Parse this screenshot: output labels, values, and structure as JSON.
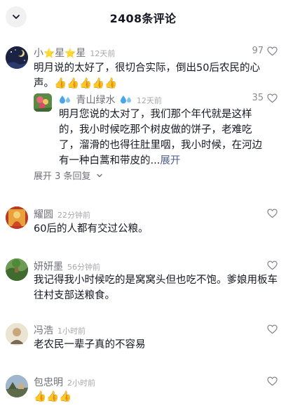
{
  "header": {
    "title": "2408条评论"
  },
  "comments": [
    {
      "username_parts": [
        "小",
        "⭐",
        "星",
        "⭐",
        "星"
      ],
      "time": "12天前",
      "likes": "97",
      "text": "明月说的太好了，很切合实际，倒出50后农民的心声。",
      "emoji": "👍👍👍👍👍",
      "reply": {
        "username": "青山绿水",
        "time": "12天前",
        "likes": "35",
        "text": "明月您说的太对了，我们那个年代就是这样的，我小时候吃那个树皮做的饼子，老难吃了，溜滑的也得往肚里咽，我小时候，在河边有一种白蒿和带皮的...",
        "expand_label": "展开"
      },
      "more_replies": "展开 3 条回复"
    },
    {
      "username": "耀圆",
      "time": "22分钟前",
      "text": "60后的人都有交过公粮。"
    },
    {
      "username": "妍妍墨",
      "time": "56分钟前",
      "text": "我记得我小时候吃的是窝窝头但也吃不饱。爹娘用板车往村支部送粮食。"
    },
    {
      "username": "冯浩",
      "time": "1小时前",
      "text": "老农民一辈子真的不容易"
    },
    {
      "username": "包忠明",
      "time": "2小时前",
      "emoji": "👍👍👍"
    }
  ]
}
